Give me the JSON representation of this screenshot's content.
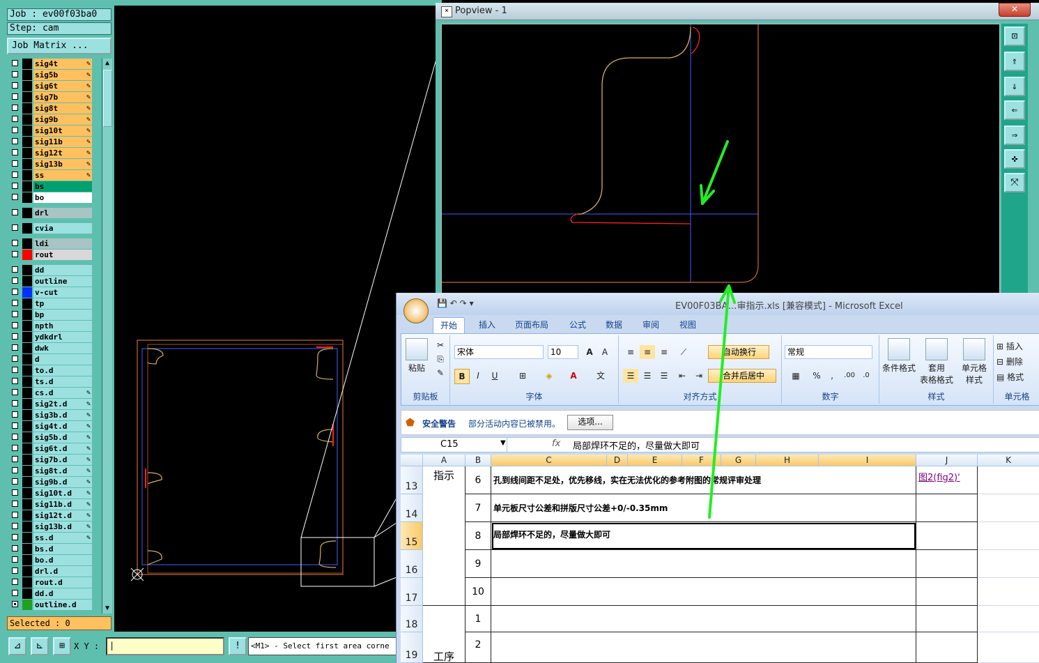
{
  "cam": {
    "job_label": "Job : ev00f03ba0",
    "step_label": "Step: cam",
    "job_matrix_button": "Job Matrix ...",
    "selected_label": "Selected : 0",
    "xy_label": "X Y :",
    "prompt": "<M1> - Select first area corne",
    "layers": [
      {
        "name": "sig4t",
        "color": "#ffc060",
        "pen": true
      },
      {
        "name": "sig5b",
        "color": "#ffc060",
        "pen": true
      },
      {
        "name": "sig6t",
        "color": "#ffc060",
        "pen": true
      },
      {
        "name": "sig7b",
        "color": "#ffc060",
        "pen": true
      },
      {
        "name": "sig8t",
        "color": "#ffc060",
        "pen": true
      },
      {
        "name": "sig9b",
        "color": "#ffc060",
        "pen": true
      },
      {
        "name": "sig10t",
        "color": "#ffc060",
        "pen": true
      },
      {
        "name": "sig11b",
        "color": "#ffc060",
        "pen": true
      },
      {
        "name": "sig12t",
        "color": "#ffc060",
        "pen": true
      },
      {
        "name": "sig13b",
        "color": "#ffc060",
        "pen": true
      },
      {
        "name": "ss",
        "color": "#ffc060",
        "pen": true
      },
      {
        "name": "bs",
        "color": "#00a070",
        "pen": false
      },
      {
        "name": "bo",
        "color": "#ffffff",
        "pen": false
      },
      {
        "name": "drl",
        "color": "#a8c4c4",
        "pen": false
      },
      {
        "name": "cvia",
        "color": "#9ce0e0",
        "pen": false
      },
      {
        "name": "ldi",
        "color": "#a8c4c4",
        "pen": false
      },
      {
        "name": "rout",
        "color": "#d8d8d8",
        "pen": false,
        "swatch": "#ff0000"
      },
      {
        "name": "dd",
        "color": "#9ce0e0",
        "pen": false
      },
      {
        "name": "outline",
        "color": "#9ce0e0",
        "pen": false
      },
      {
        "name": "v-cut",
        "color": "#9ce0e0",
        "pen": false,
        "swatch": "#0030ff"
      },
      {
        "name": "tp",
        "color": "#9ce0e0",
        "pen": false
      },
      {
        "name": "bp",
        "color": "#9ce0e0",
        "pen": false
      },
      {
        "name": "npth",
        "color": "#9ce0e0",
        "pen": false
      },
      {
        "name": "ydkdrl",
        "color": "#9ce0e0",
        "pen": false
      },
      {
        "name": "dwk",
        "color": "#9ce0e0",
        "pen": false
      },
      {
        "name": "d",
        "color": "#9ce0e0",
        "pen": false
      },
      {
        "name": "to.d",
        "color": "#9ce0e0",
        "pen": false
      },
      {
        "name": "ts.d",
        "color": "#9ce0e0",
        "pen": false
      },
      {
        "name": "cs.d",
        "color": "#9ce0e0",
        "pen": true
      },
      {
        "name": "sig2t.d",
        "color": "#9ce0e0",
        "pen": true
      },
      {
        "name": "sig3b.d",
        "color": "#9ce0e0",
        "pen": true
      },
      {
        "name": "sig4t.d",
        "color": "#9ce0e0",
        "pen": true
      },
      {
        "name": "sig5b.d",
        "color": "#9ce0e0",
        "pen": true
      },
      {
        "name": "sig6t.d",
        "color": "#9ce0e0",
        "pen": true
      },
      {
        "name": "sig7b.d",
        "color": "#9ce0e0",
        "pen": true
      },
      {
        "name": "sig8t.d",
        "color": "#9ce0e0",
        "pen": true
      },
      {
        "name": "sig9b.d",
        "color": "#9ce0e0",
        "pen": true
      },
      {
        "name": "sig10t.d",
        "color": "#9ce0e0",
        "pen": true
      },
      {
        "name": "sig11b.d",
        "color": "#9ce0e0",
        "pen": true
      },
      {
        "name": "sig12t.d",
        "color": "#9ce0e0",
        "pen": true
      },
      {
        "name": "sig13b.d",
        "color": "#9ce0e0",
        "pen": true
      },
      {
        "name": "ss.d",
        "color": "#9ce0e0",
        "pen": true
      },
      {
        "name": "bs.d",
        "color": "#9ce0e0",
        "pen": false
      },
      {
        "name": "bo.d",
        "color": "#9ce0e0",
        "pen": false
      },
      {
        "name": "drl.d",
        "color": "#9ce0e0",
        "pen": false
      },
      {
        "name": "rout.d",
        "color": "#9ce0e0",
        "pen": false
      },
      {
        "name": "dd.d",
        "color": "#9ce0e0",
        "pen": false
      },
      {
        "name": "outline.d",
        "color": "#9ce0e0",
        "pen": false,
        "checked": true,
        "swatch": "#20a020"
      }
    ]
  },
  "popview": {
    "title": "Popview - 1",
    "close": "✕"
  },
  "excel": {
    "title": "EV00F03BA…审指示.xls  [兼容模式]  -  Microsoft Excel",
    "tabs": [
      "开始",
      "插入",
      "页面布局",
      "公式",
      "数据",
      "审阅",
      "视图"
    ],
    "ribbon": {
      "paste": "粘贴",
      "clipboard": "剪贴板",
      "font_name": "宋体",
      "font_size": "10",
      "font_group": "字体",
      "wrap_text": "自动换行",
      "merge_center": "合并后居中",
      "align_group": "对齐方式",
      "number_format": "常规",
      "number_group": "数字",
      "cond_format": "条件格式",
      "table_format": "套用\n表格格式",
      "cell_style": "单元格\n样式",
      "styles_group": "样式",
      "insert": "插入",
      "delete": "删除",
      "format": "格式",
      "cells_group": "单元格"
    },
    "security": {
      "title": "安全警告",
      "message": "部分活动内容已被禁用。",
      "button": "选项..."
    },
    "name_box": "C15",
    "fx": "fx",
    "formula": "局部焊环不足的，尽量做大即可",
    "columns": [
      "A",
      "B",
      "C",
      "D",
      "E",
      "F",
      "G",
      "H",
      "I",
      "J",
      "K"
    ],
    "rows": [
      {
        "row": "13",
        "num": "6",
        "text": "孔到线间距不足处，优先移线，实在无法优化的参考附图的常规评审处理",
        "link": "图2(fig2)'"
      },
      {
        "row": "14",
        "num": "7",
        "text": "单元板尺寸公差和拼版尺寸公差+0/-0.35mm",
        "link": ""
      },
      {
        "row": "15",
        "num": "8",
        "text": "局部焊环不足的，尽量做大即可",
        "link": ""
      },
      {
        "row": "16",
        "num": "9",
        "text": "",
        "link": ""
      },
      {
        "row": "17",
        "num": "10",
        "text": "",
        "link": ""
      },
      {
        "row": "18",
        "num": "1",
        "text": "",
        "link": ""
      },
      {
        "row": "19",
        "num": "2",
        "text": "",
        "link": ""
      }
    ],
    "merged_a_label": "指示",
    "merged_a2_label": "工序"
  }
}
